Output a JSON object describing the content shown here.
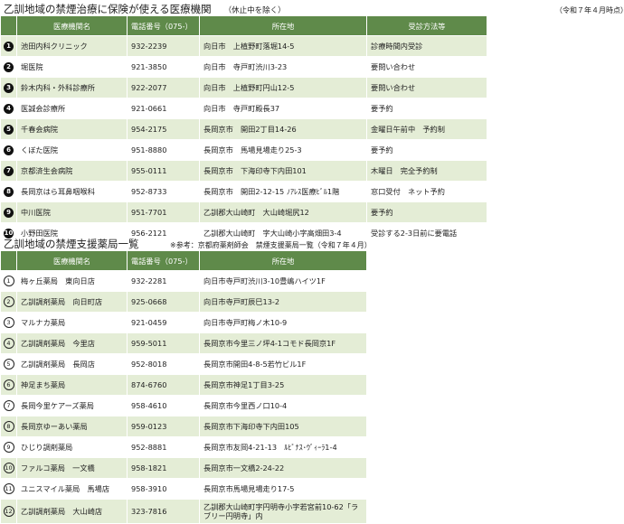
{
  "section1": {
    "title": "乙訓地域の禁煙治療に保険が使える医療機関",
    "note": "（休止中を除く）",
    "date_note": "（令和７年４月時点）",
    "headers": [
      "医療機関名",
      "電話番号（075-）",
      "所在地",
      "受診方法等"
    ],
    "rows": [
      {
        "no": "1",
        "name": "池田内科クリニック",
        "tel": "932-2239",
        "address": "向日市　上植野町落堀14-5",
        "method": "診療時間内受診"
      },
      {
        "no": "2",
        "name": "堀医院",
        "tel": "921-3850",
        "address": "向日市　寺戸町渋川3-23",
        "method": "要問い合わせ"
      },
      {
        "no": "3",
        "name": "鈴木内科・外科診療所",
        "tel": "922-2077",
        "address": "向日市　上植野町円山12-5",
        "method": "要問い合わせ"
      },
      {
        "no": "4",
        "name": "医誠会診療所",
        "tel": "921-0661",
        "address": "向日市　寺戸町殿長37",
        "method": "要予約"
      },
      {
        "no": "5",
        "name": "千春会病院",
        "tel": "954-2175",
        "address": "長岡京市　開田2丁目14-26",
        "method": "金曜日午前中　予約制"
      },
      {
        "no": "6",
        "name": "くぼた医院",
        "tel": "951-8880",
        "address": "長岡京市　馬場見場走り25-3",
        "method": "要予約"
      },
      {
        "no": "7",
        "name": "京都済生会病院",
        "tel": "955-0111",
        "address": "長岡京市　下海印寺下内田101",
        "method": "木曜日　完全予約制"
      },
      {
        "no": "8",
        "name": "長岡京はら耳鼻咽喉科",
        "tel": "952-8733",
        "address": "長岡京市　開田2-12-15 ﾉｱﾚｽ医療ﾋﾞﾙ1階",
        "method": "窓口受付　ネット予約"
      },
      {
        "no": "9",
        "name": "中川医院",
        "tel": "951-7701",
        "address": "乙訓郡大山崎町　大山崎堀尻12",
        "method": "要予約"
      },
      {
        "no": "10",
        "name": "小野田医院",
        "tel": "956-2121",
        "address": "乙訓郡大山崎町　字大山崎小字高畑田3-4",
        "method": "受診する2-3日前に要電話"
      }
    ]
  },
  "section2": {
    "title": "乙訓地域の禁煙支援薬局一覧",
    "note": "※参考：京都府薬剤師会　禁煙支援薬局一覧（令和７年４月）",
    "headers": [
      "医療機関名",
      "電話番号（075-）",
      "所在地"
    ],
    "rows": [
      {
        "no": "1",
        "name": "梅ヶ丘薬局　東向日店",
        "tel": "932-2281",
        "address": "向日市寺戸町渋川3-10豊嶋ハイツ1F"
      },
      {
        "no": "2",
        "name": "乙訓調剤薬局　向日町店",
        "tel": "925-0668",
        "address": "向日市寺戸町辰巳13-2"
      },
      {
        "no": "3",
        "name": "マルナカ薬局",
        "tel": "921-0459",
        "address": "向日市寺戸町梅ノ木10-9"
      },
      {
        "no": "4",
        "name": "乙訓調剤薬局　今里店",
        "tel": "959-5011",
        "address": "長岡京市今里三ノ坪4-1コモド長岡京1F"
      },
      {
        "no": "5",
        "name": "乙訓調剤薬局　長岡店",
        "tel": "952-8018",
        "address": "長岡京市開田4-8-5若竹ビル1F"
      },
      {
        "no": "6",
        "name": "神足まち薬局",
        "tel": "874-6760",
        "address": "長岡京市神足1丁目3-25"
      },
      {
        "no": "7",
        "name": "長岡今里ケアーズ薬局",
        "tel": "958-4610",
        "address": "長岡京市今里西ノ口10-4"
      },
      {
        "no": "8",
        "name": "長岡京ゆーあい薬局",
        "tel": "959-0123",
        "address": "長岡京市下海印寺下内田105"
      },
      {
        "no": "9",
        "name": "ひじり調剤薬局",
        "tel": "952-8881",
        "address": "長岡京市友岡4-21-13　ﾙﾋﾟﾅｽ･ｳﾞｨｰﾗ1-4"
      },
      {
        "no": "10",
        "name": "ファルコ薬局　一文橋",
        "tel": "958-1821",
        "address": "長岡京市一文橋2-24-22"
      },
      {
        "no": "11",
        "name": "ユニスマイル薬局　馬場店",
        "tel": "958-3910",
        "address": "長岡京市馬場見場走り17-5"
      },
      {
        "no": "12",
        "name": "乙訓調剤薬局　大山崎店",
        "tel": "323-7816",
        "address": "乙訓郡大山崎町字円明寺小字若宮前10-62「ラブリー円明寺」内"
      }
    ]
  }
}
